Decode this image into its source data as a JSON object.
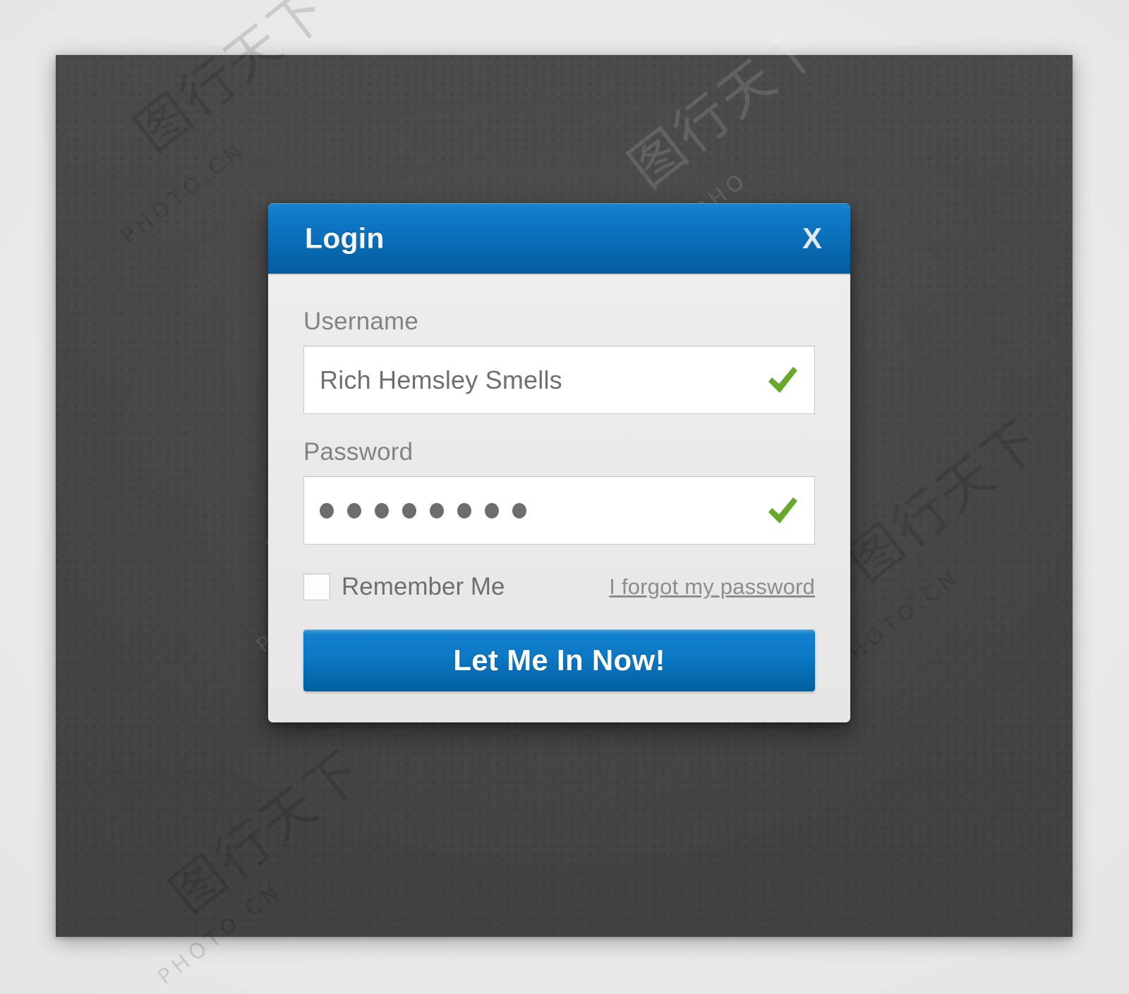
{
  "dialog": {
    "title": "Login",
    "close_label": "X",
    "username": {
      "label": "Username",
      "value": "Rich Hemsley Smells",
      "placeholder": "Username",
      "valid_icon": "green-check-icon"
    },
    "password": {
      "label": "Password",
      "value": "••••••••",
      "masked_char_count": 8,
      "placeholder": "Password",
      "valid_icon": "green-check-icon"
    },
    "remember": {
      "label": "Remember Me",
      "checked": false
    },
    "forgot_link": "I forgot my password",
    "submit_label": "Let Me In Now!"
  },
  "colors": {
    "title_bar_top": "#1b84d0",
    "title_bar_bottom": "#045b9d",
    "button_top": "#1280cd",
    "button_bottom": "#025f9e",
    "check_green": "#68a82c",
    "panel_dark": "#464646",
    "dialog_body": "#eaeaea",
    "label_gray": "#838383"
  },
  "watermarks": {
    "cjk": "图行天下",
    "latin_top": "PHOTO.CN",
    "latin_mid": "PHOTOPHO",
    "latin_bottom": "PHOTO.CN",
    "registered": "®"
  }
}
